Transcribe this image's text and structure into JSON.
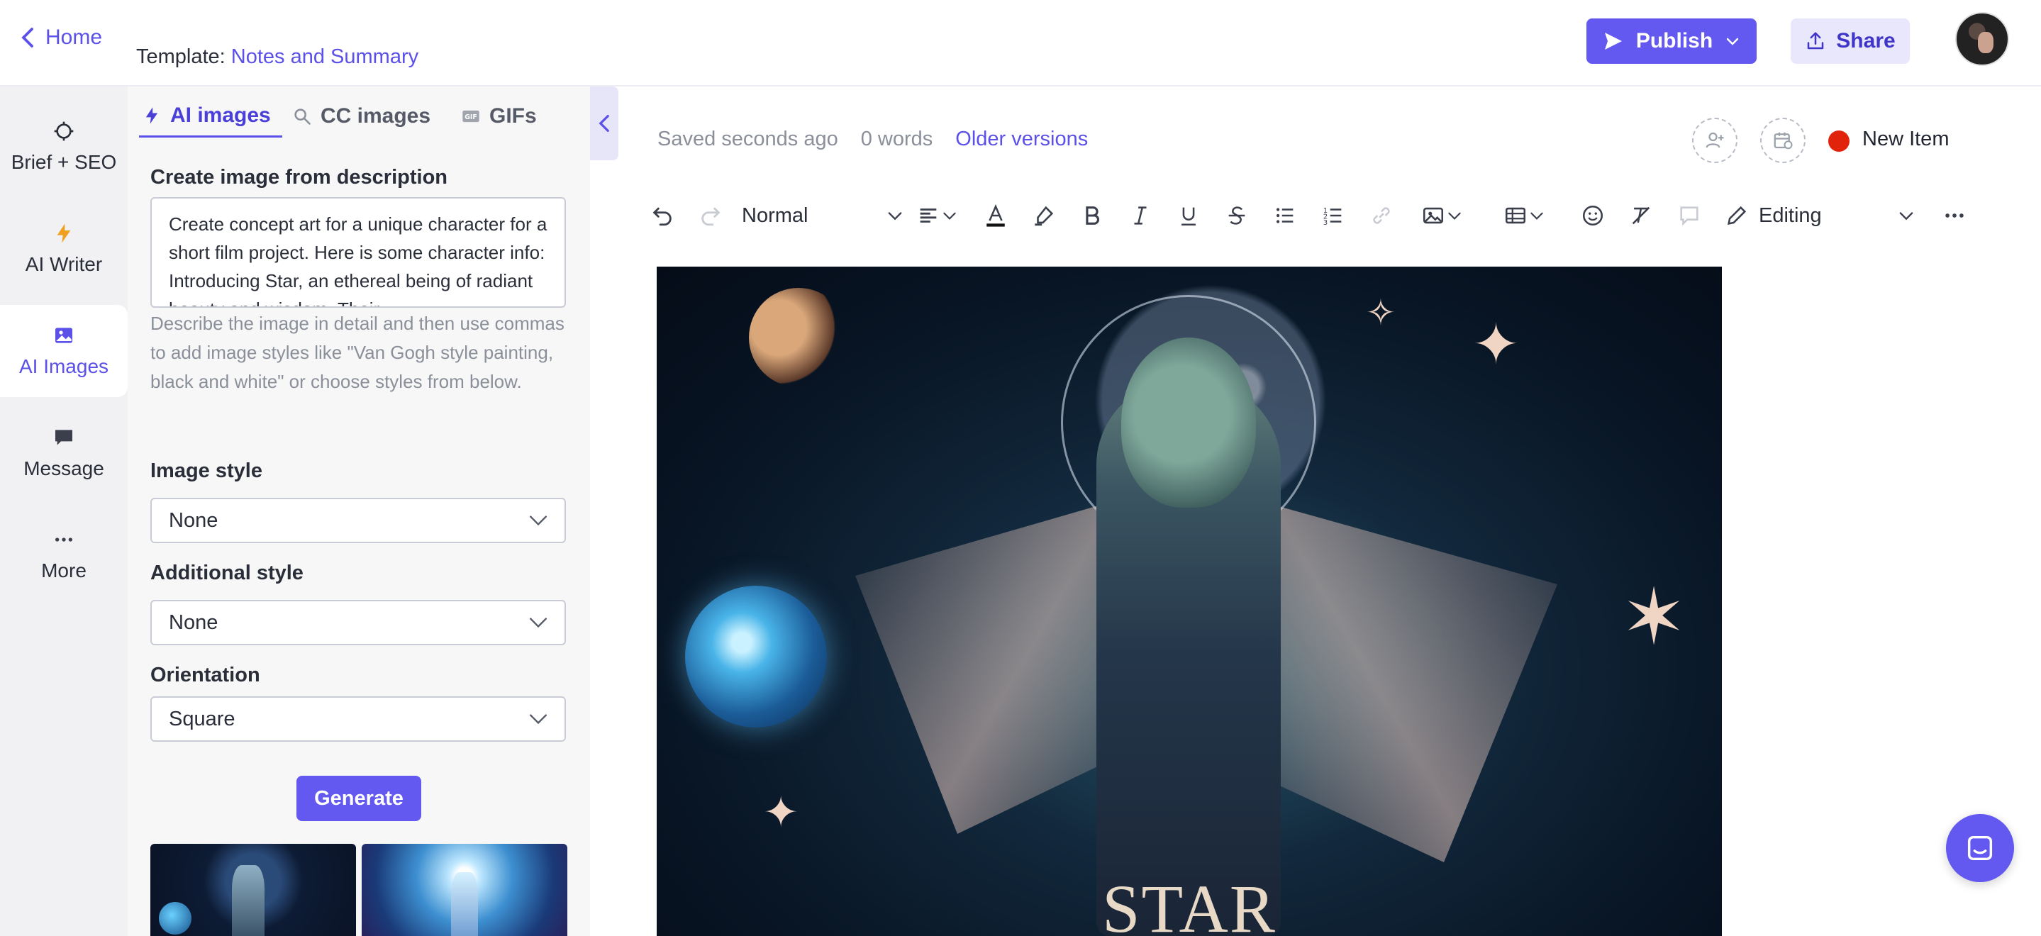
{
  "header": {
    "home_label": "Home",
    "template_prefix": "Template:",
    "template_name": "Notes and Summary",
    "publish_label": "Publish",
    "share_label": "Share"
  },
  "rail": {
    "items": [
      {
        "label": "Brief + SEO",
        "icon": "crosshair-icon"
      },
      {
        "label": "AI Writer",
        "icon": "lightning-icon"
      },
      {
        "label": "AI Images",
        "icon": "image-icon",
        "active": true
      },
      {
        "label": "Message",
        "icon": "chat-icon"
      },
      {
        "label": "More",
        "icon": "more-dots-icon"
      }
    ]
  },
  "panel": {
    "tabs": [
      {
        "label": "AI images",
        "icon": "lightning-icon",
        "active": true
      },
      {
        "label": "CC images",
        "icon": "search-icon"
      },
      {
        "label": "GIFs",
        "icon": "gif-icon"
      }
    ],
    "description_label": "Create image from description",
    "description_value": "Create concept art for a unique character for a short film project. Here is some character info: Introducing Star, an ethereal being of radiant beauty and wisdom. Their",
    "help_text": "Describe the image in detail and then use commas to add image styles like \"Van Gogh style painting, black and white\" or choose styles from below.",
    "image_style_label": "Image style",
    "image_style_value": "None",
    "additional_style_label": "Additional style",
    "additional_style_value": "None",
    "orientation_label": "Orientation",
    "orientation_value": "Square",
    "generate_label": "Generate"
  },
  "editor": {
    "saved_status": "Saved seconds ago",
    "word_count": "0 words",
    "older_versions": "Older versions",
    "status_label": "New Item",
    "status_color": "#e2230b",
    "toolbar": {
      "paragraph_style": "Normal",
      "mode": "Editing"
    },
    "image_caption": "STAR"
  },
  "colors": {
    "accent": "#6358ef",
    "accent_text": "#5b50e8"
  }
}
